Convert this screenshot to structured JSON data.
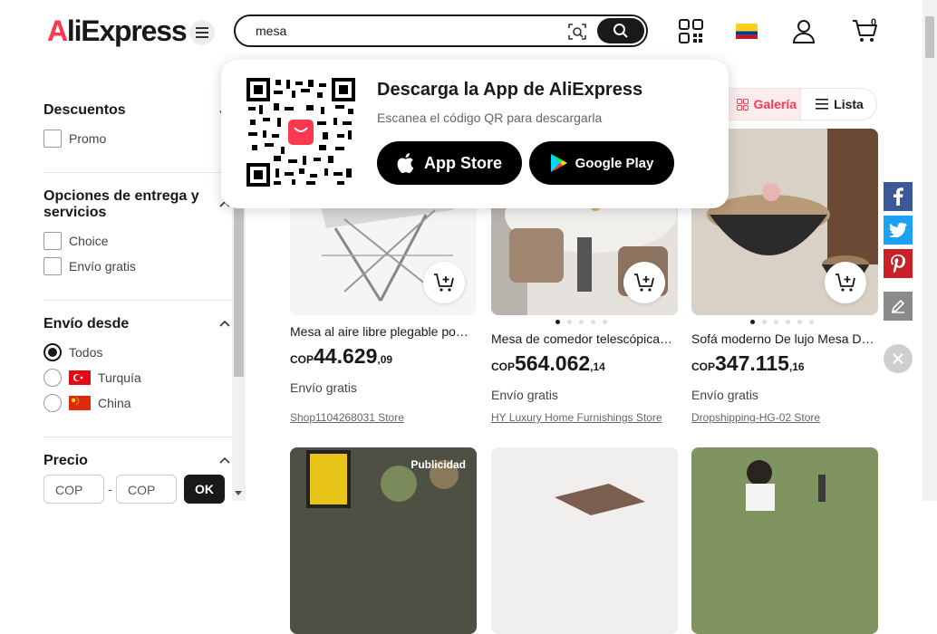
{
  "header": {
    "logo_a": "A",
    "logo_rest": "liExpress",
    "search_value": "mesa",
    "cart_count": "0"
  },
  "filters": {
    "descuentos": {
      "title": "Descuentos",
      "options": [
        "Promo"
      ]
    },
    "entrega": {
      "title_line1": "Opciones de entrega y",
      "title_line2": "servicios",
      "options": [
        "Choice",
        "Envío gratis"
      ]
    },
    "envio_desde": {
      "title": "Envío desde",
      "options": [
        "Todos",
        "Turquía",
        "China"
      ],
      "selected": "Todos"
    },
    "precio": {
      "title": "Precio",
      "min_placeholder": "COP",
      "max_placeholder": "COP",
      "separator": "-",
      "ok_label": "OK"
    }
  },
  "view_toggle": {
    "gallery_label": "Galería",
    "list_label": "Lista",
    "active": "Galería"
  },
  "popup": {
    "title": "Descarga la App de AliExpress",
    "subtitle": "Escanea el código QR para descargarla",
    "app_store_label": "App Store",
    "google_play_label": "Google Play"
  },
  "products": [
    {
      "title": "Mesa al aire libre plegable po…",
      "currency": "COP",
      "price_int": "44.629",
      "price_dec": ",09",
      "shipping": "Envío gratis",
      "store": "Shop1104268031 Store"
    },
    {
      "title": "Mesa de comedor telescópica…",
      "currency": "COP",
      "price_int": "564.062",
      "price_dec": ",14",
      "shipping": "Envío gratis",
      "store": "HY Luxury Home Furnishings Store"
    },
    {
      "title": "Sofá moderno De lujo Mesa D…",
      "currency": "COP",
      "price_int": "347.115",
      "price_dec": ",16",
      "shipping": "Envío gratis",
      "store": "Dropshipping-HG-02 Store"
    }
  ],
  "ad_label": "Publicidad",
  "colors": {
    "brand_red": "#fd384f",
    "dark": "#191919",
    "facebook": "#3b5998",
    "twitter": "#1da1f2",
    "pinterest": "#cb2027",
    "edit": "#8a8a8a"
  },
  "icons": [
    "menu-icon",
    "camera-icon",
    "search-icon",
    "qr-code-icon",
    "colombia-flag-icon",
    "user-icon",
    "cart-icon",
    "chevron-up-icon",
    "gallery-grid-icon",
    "list-icon",
    "apple-icon",
    "google-play-icon",
    "add-to-cart-icon",
    "facebook-icon",
    "twitter-icon",
    "pinterest-icon",
    "edit-icon",
    "close-icon"
  ]
}
